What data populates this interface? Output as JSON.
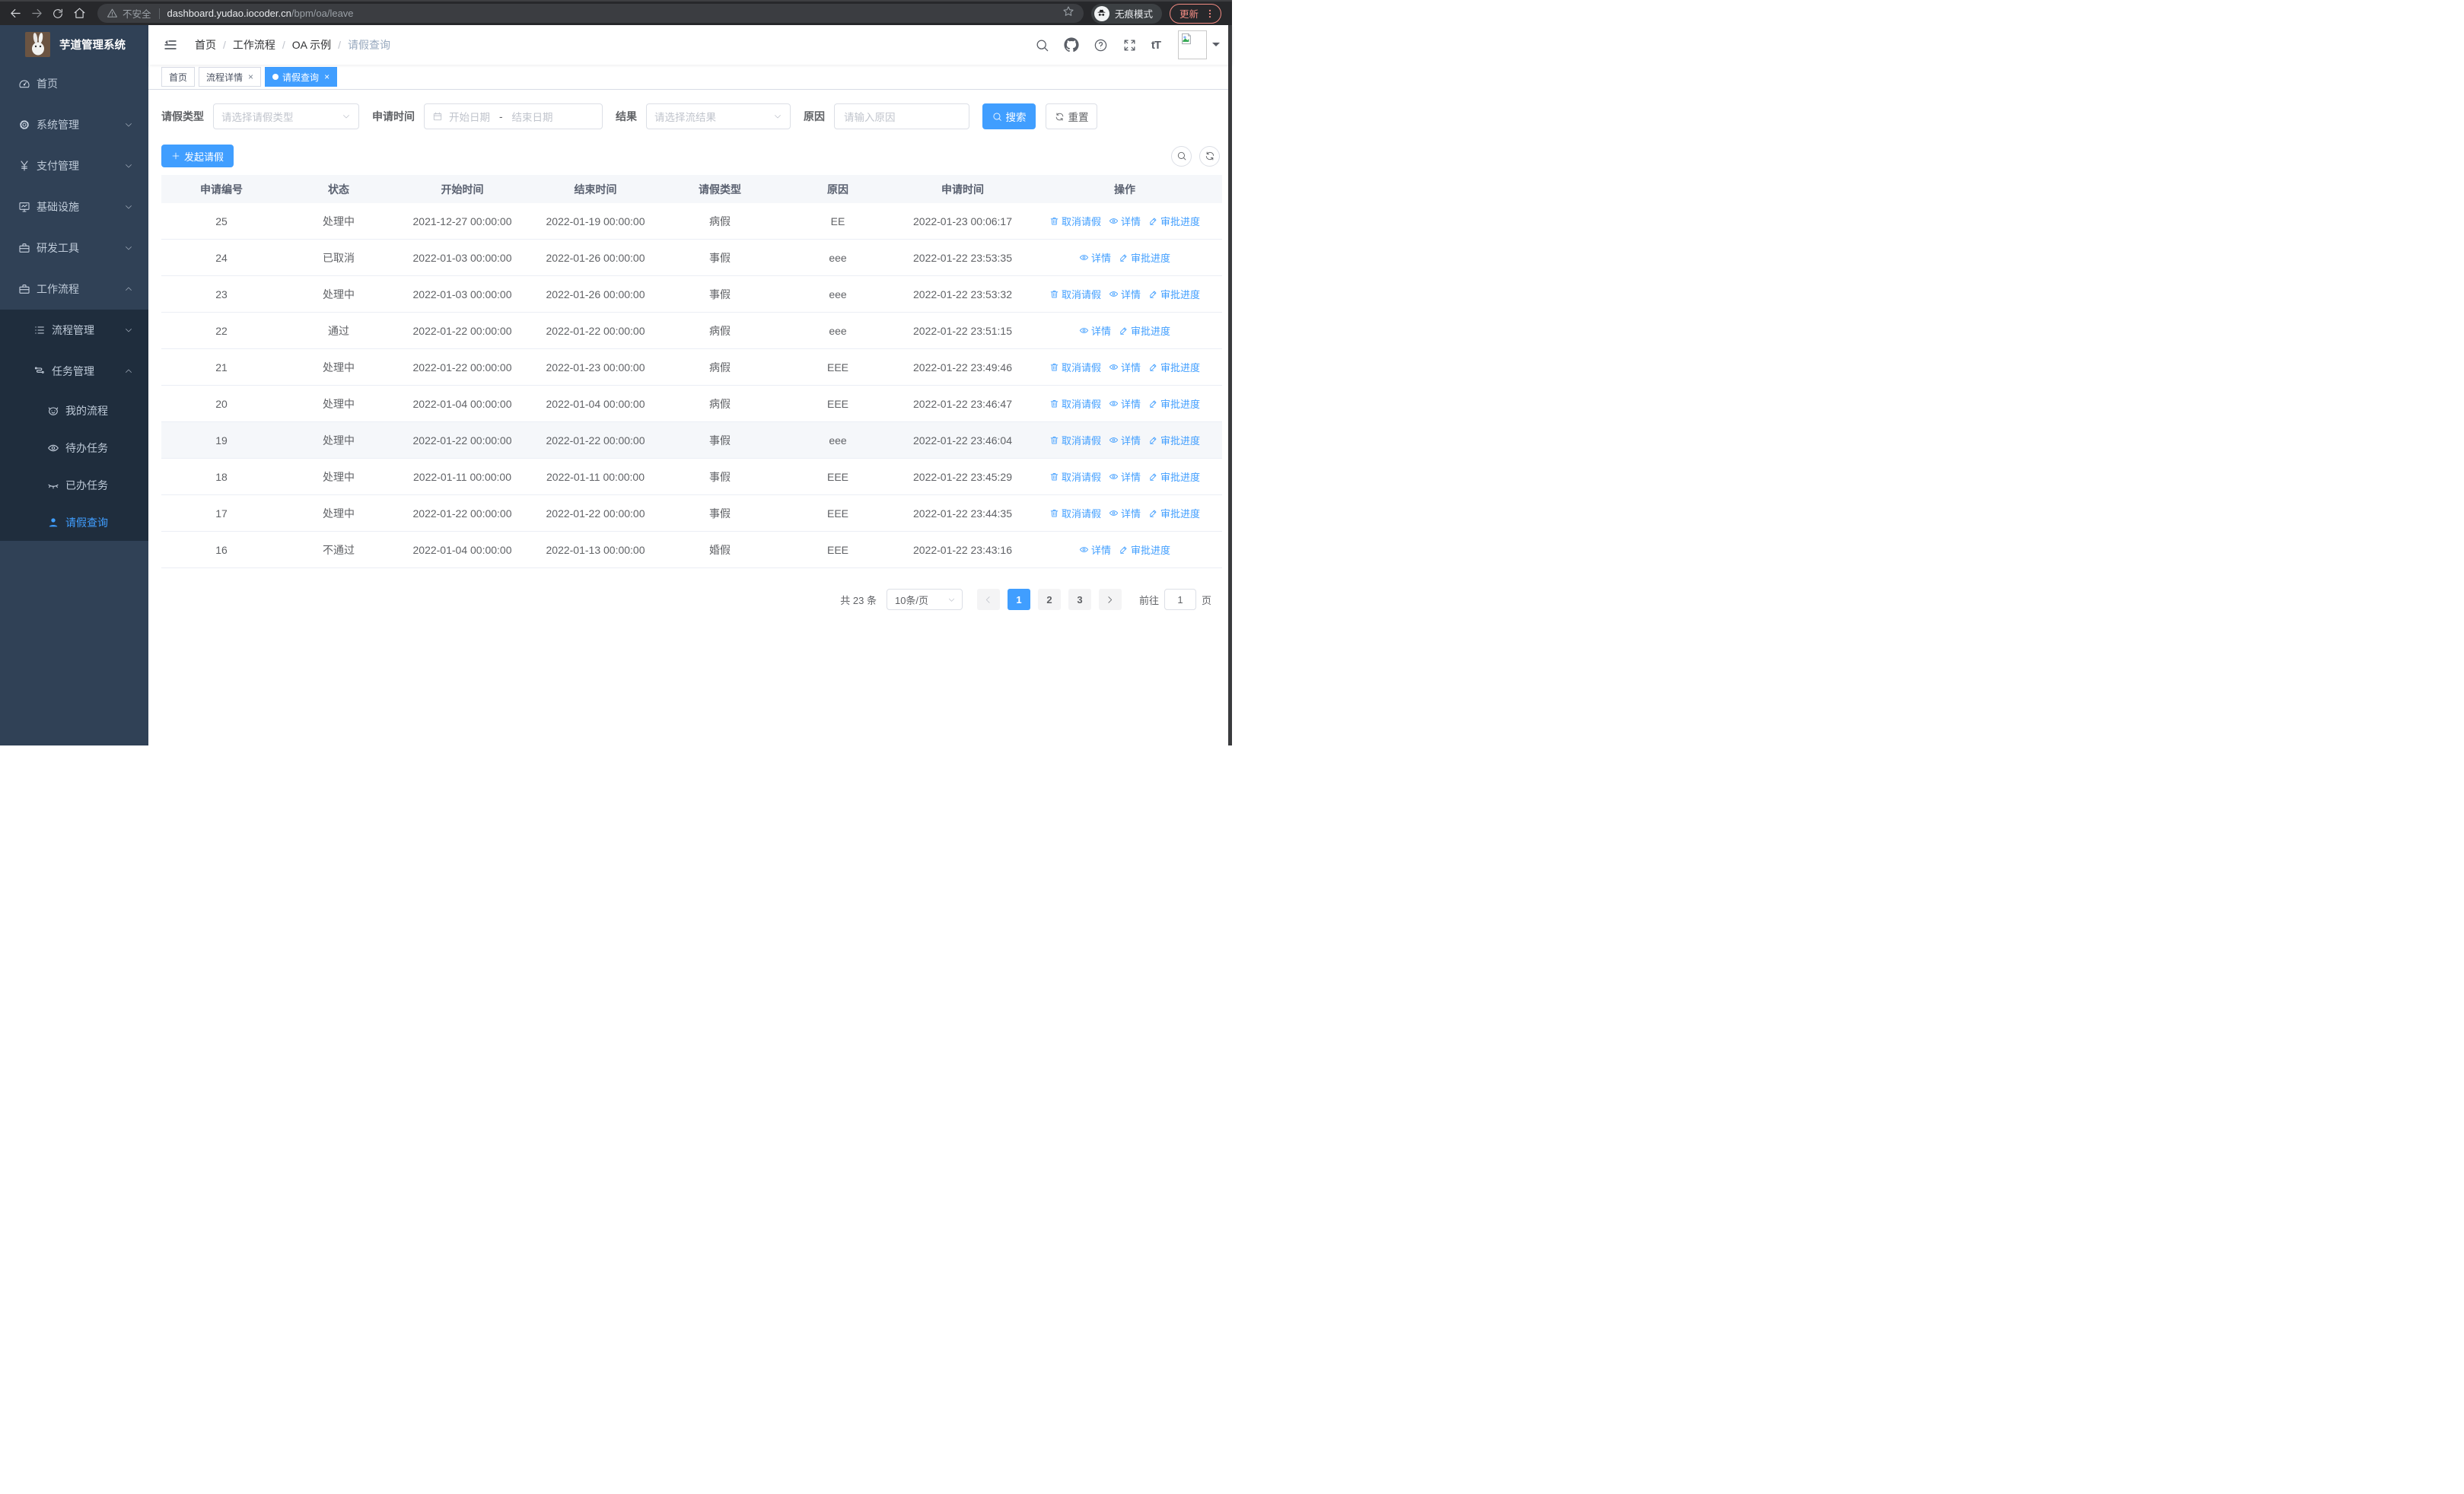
{
  "browser": {
    "security_label": "不安全",
    "url_host": "dashboard.yudao.iocoder.cn",
    "url_path": "/bpm/oa/leave",
    "incognito_label": "无痕模式",
    "update_label": "更新"
  },
  "sidebar": {
    "title": "芋道管理系统",
    "menu": [
      {
        "label": "首页"
      },
      {
        "label": "系统管理"
      },
      {
        "label": "支付管理"
      },
      {
        "label": "基础设施"
      },
      {
        "label": "研发工具"
      },
      {
        "label": "工作流程"
      }
    ],
    "submenu": [
      {
        "label": "流程管理"
      },
      {
        "label": "任务管理"
      }
    ],
    "tasks": [
      {
        "label": "我的流程"
      },
      {
        "label": "待办任务"
      },
      {
        "label": "已办任务"
      },
      {
        "label": "请假查询"
      }
    ]
  },
  "header": {
    "breadcrumb": [
      "首页",
      "工作流程",
      "OA 示例",
      "请假查询"
    ],
    "breadcrumb_separator": "/",
    "tabs": [
      {
        "label": "首页"
      },
      {
        "label": "流程详情"
      },
      {
        "label": "请假查询"
      }
    ],
    "close_glyph": "×"
  },
  "filters": {
    "leave_type_label": "请假类型",
    "leave_type_placeholder": "请选择请假类型",
    "apply_time_label": "申请时间",
    "start_date_placeholder": "开始日期",
    "range_separator": "-",
    "end_date_placeholder": "结束日期",
    "result_label": "结果",
    "result_placeholder": "请选择流结果",
    "reason_label": "原因",
    "reason_placeholder": "请输入原因",
    "search_label": "搜索",
    "reset_label": "重置"
  },
  "toolbar": {
    "create_label": "发起请假"
  },
  "table": {
    "columns": [
      "申请编号",
      "状态",
      "开始时间",
      "结束时间",
      "请假类型",
      "原因",
      "申请时间",
      "操作"
    ],
    "actions": {
      "cancel": "取消请假",
      "detail": "详情",
      "progress": "审批进度"
    },
    "rows": [
      {
        "id": "25",
        "status": "处理中",
        "start": "2021-12-27 00:00:00",
        "end": "2022-01-19 00:00:00",
        "type": "病假",
        "reason": "EE",
        "applied": "2022-01-23 00:06:17",
        "cancellable": true,
        "highlighted": false
      },
      {
        "id": "24",
        "status": "已取消",
        "start": "2022-01-03 00:00:00",
        "end": "2022-01-26 00:00:00",
        "type": "事假",
        "reason": "eee",
        "applied": "2022-01-22 23:53:35",
        "cancellable": false,
        "highlighted": false
      },
      {
        "id": "23",
        "status": "处理中",
        "start": "2022-01-03 00:00:00",
        "end": "2022-01-26 00:00:00",
        "type": "事假",
        "reason": "eee",
        "applied": "2022-01-22 23:53:32",
        "cancellable": true,
        "highlighted": false
      },
      {
        "id": "22",
        "status": "通过",
        "start": "2022-01-22 00:00:00",
        "end": "2022-01-22 00:00:00",
        "type": "病假",
        "reason": "eee",
        "applied": "2022-01-22 23:51:15",
        "cancellable": false,
        "highlighted": false
      },
      {
        "id": "21",
        "status": "处理中",
        "start": "2022-01-22 00:00:00",
        "end": "2022-01-23 00:00:00",
        "type": "病假",
        "reason": "EEE",
        "applied": "2022-01-22 23:49:46",
        "cancellable": true,
        "highlighted": false
      },
      {
        "id": "20",
        "status": "处理中",
        "start": "2022-01-04 00:00:00",
        "end": "2022-01-04 00:00:00",
        "type": "病假",
        "reason": "EEE",
        "applied": "2022-01-22 23:46:47",
        "cancellable": true,
        "highlighted": false
      },
      {
        "id": "19",
        "status": "处理中",
        "start": "2022-01-22 00:00:00",
        "end": "2022-01-22 00:00:00",
        "type": "事假",
        "reason": "eee",
        "applied": "2022-01-22 23:46:04",
        "cancellable": true,
        "highlighted": true
      },
      {
        "id": "18",
        "status": "处理中",
        "start": "2022-01-11 00:00:00",
        "end": "2022-01-11 00:00:00",
        "type": "事假",
        "reason": "EEE",
        "applied": "2022-01-22 23:45:29",
        "cancellable": true,
        "highlighted": false
      },
      {
        "id": "17",
        "status": "处理中",
        "start": "2022-01-22 00:00:00",
        "end": "2022-01-22 00:00:00",
        "type": "事假",
        "reason": "EEE",
        "applied": "2022-01-22 23:44:35",
        "cancellable": true,
        "highlighted": false
      },
      {
        "id": "16",
        "status": "不通过",
        "start": "2022-01-04 00:00:00",
        "end": "2022-01-13 00:00:00",
        "type": "婚假",
        "reason": "EEE",
        "applied": "2022-01-22 23:43:16",
        "cancellable": false,
        "highlighted": false
      }
    ]
  },
  "pagination": {
    "total_label": "共 23 条",
    "page_size": "10条/页",
    "pages": [
      "1",
      "2",
      "3"
    ],
    "active_page": "1",
    "goto_label": "前往",
    "goto_value": "1",
    "page_label": "页"
  },
  "colors": {
    "accent": "#409eff",
    "sidebar_bg": "#304156",
    "submenu_bg": "#1f2d3d",
    "update": "#f28b82"
  }
}
